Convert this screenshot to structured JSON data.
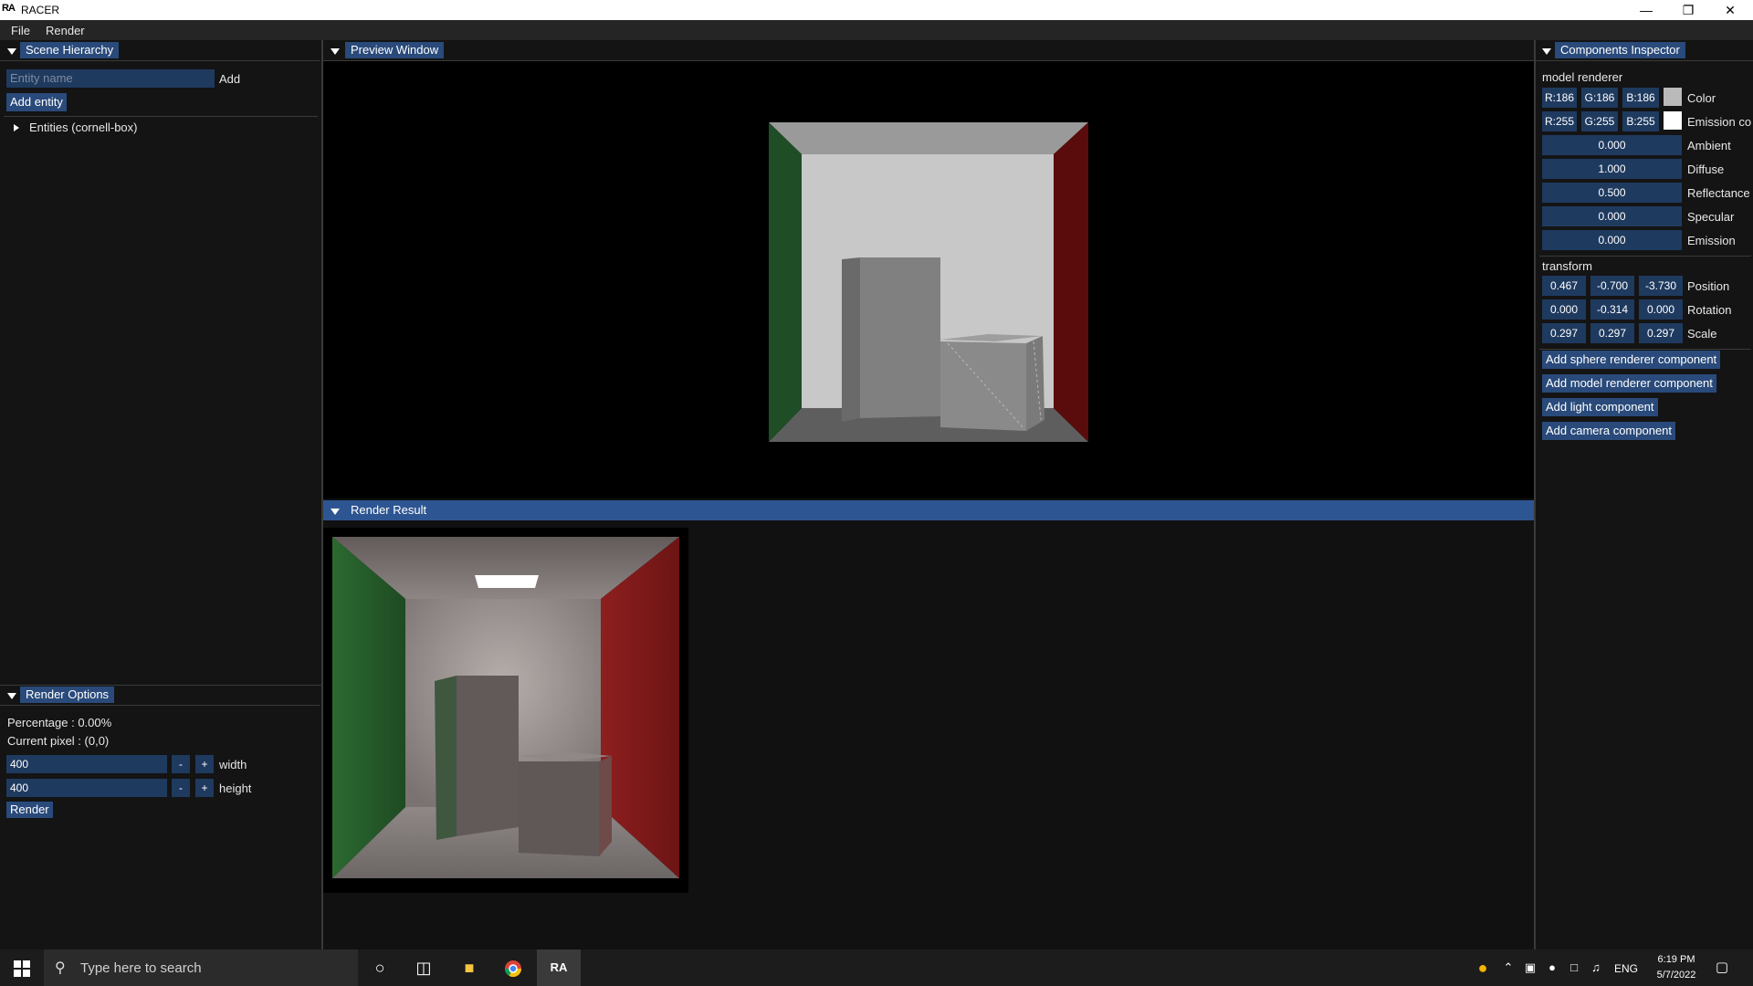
{
  "window": {
    "title": "RACER",
    "app_icon": "RA"
  },
  "menu": {
    "file": "File",
    "render": "Render"
  },
  "scene_hierarchy": {
    "title": "Scene Hierarchy",
    "entity_placeholder": "Entity name",
    "add_label": "Add",
    "add_entity_label": "Add entity",
    "tree_root": "Entities (cornell-box)"
  },
  "preview": {
    "title": "Preview Window"
  },
  "render_result": {
    "title": "Render Result"
  },
  "render_options": {
    "title": "Render Options",
    "percentage": "Percentage : 0.00%",
    "current_pixel": "Current pixel : (0,0)",
    "width_value": "400",
    "width_label": "width",
    "height_value": "400",
    "height_label": "height",
    "minus": "-",
    "plus": "+",
    "render_button": "Render"
  },
  "inspector": {
    "title": "Components Inspector",
    "model_renderer": {
      "title": "model renderer",
      "color": {
        "r": "R:186",
        "g": "G:186",
        "b": "B:186",
        "label": "Color",
        "swatch": "#bababa"
      },
      "emission_color": {
        "r": "R:255",
        "g": "G:255",
        "b": "B:255",
        "label": "Emission co",
        "swatch": "#ffffff"
      },
      "ambient": {
        "value": "0.000",
        "label": "Ambient"
      },
      "diffuse": {
        "value": "1.000",
        "label": "Diffuse"
      },
      "reflectance": {
        "value": "0.500",
        "label": "Reflectance"
      },
      "specular": {
        "value": "0.000",
        "label": "Specular"
      },
      "emission": {
        "value": "0.000",
        "label": "Emission"
      }
    },
    "transform": {
      "title": "transform",
      "position": {
        "x": "0.467",
        "y": "-0.700",
        "z": "-3.730",
        "label": "Position"
      },
      "rotation": {
        "x": "0.000",
        "y": "-0.314",
        "z": "0.000",
        "label": "Rotation"
      },
      "scale": {
        "x": "0.297",
        "y": "0.297",
        "z": "0.297",
        "label": "Scale"
      }
    },
    "buttons": {
      "sphere": "Add sphere renderer component",
      "model": "Add model renderer component",
      "light": "Add light component",
      "camera": "Add camera component"
    }
  },
  "taskbar": {
    "search_placeholder": "Type here to search",
    "language": "ENG",
    "time": "6:19 PM",
    "date": "5/7/2022"
  },
  "colors": {
    "accent": "#294a7a",
    "field": "#1f3a5f",
    "panel": "#141414",
    "highlight_bar": "#2d5591"
  }
}
